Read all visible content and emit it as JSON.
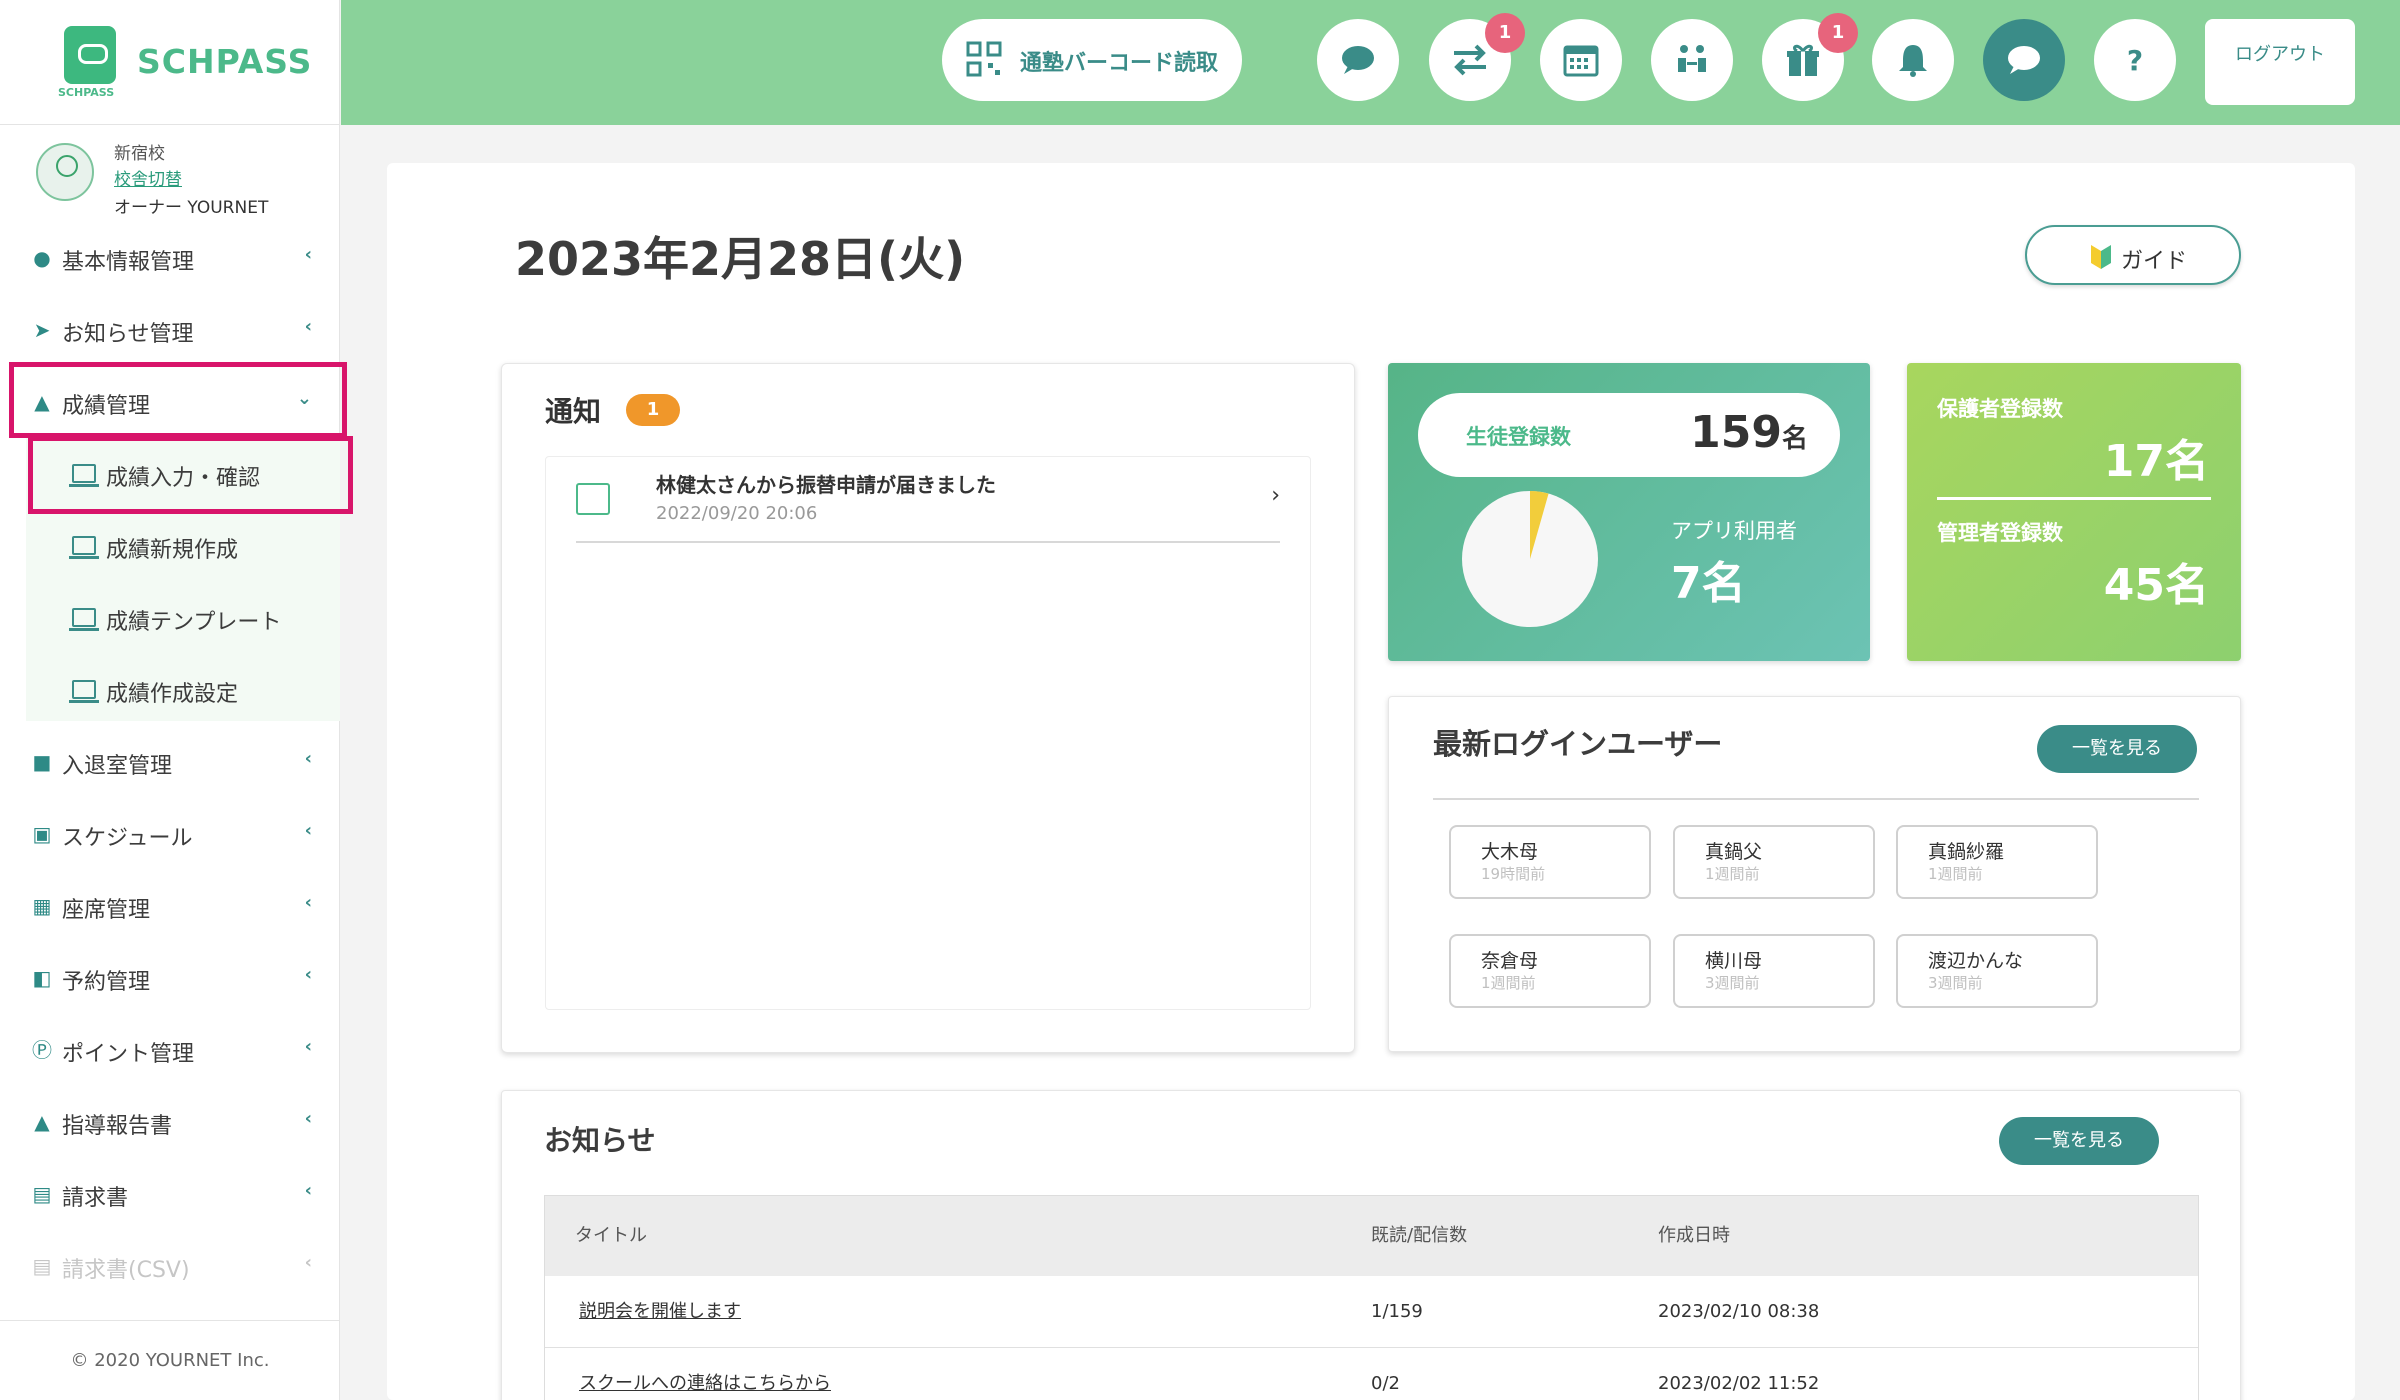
{
  "brand": {
    "name": "SCHPASS",
    "sub": "SCHPASS"
  },
  "school": {
    "name": "新宿校",
    "switch_label": "校舎切替",
    "owner": "オーナー YOURNET"
  },
  "sidebar": {
    "items": [
      {
        "label": "基本情報管理"
      },
      {
        "label": "お知らせ管理"
      },
      {
        "label": "成績管理"
      },
      {
        "label": "入退室管理"
      },
      {
        "label": "スケジュール"
      },
      {
        "label": "座席管理"
      },
      {
        "label": "予約管理"
      },
      {
        "label": "ポイント管理"
      },
      {
        "label": "指導報告書"
      },
      {
        "label": "請求書"
      },
      {
        "label": "請求書(CSV)"
      }
    ],
    "subitems": [
      {
        "label": "成績入力・確認"
      },
      {
        "label": "成績新規作成"
      },
      {
        "label": "成績テンプレート"
      },
      {
        "label": "成績作成設定"
      }
    ],
    "copyright": "© 2020 YOURNET Inc."
  },
  "topbar": {
    "barcode_label": "通塾バーコード読取",
    "badges": {
      "transfer": "1",
      "gift": "1"
    },
    "logout_label": "ログアウト"
  },
  "main": {
    "date": "2023年2月28日(火)",
    "guide_label": "ガイド"
  },
  "notifications": {
    "title": "通知",
    "count": "1",
    "items": [
      {
        "title": "林健太さんから振替申請が届きました",
        "date": "2022/09/20 20:06"
      }
    ]
  },
  "stats": {
    "students_label": "生徒登録数",
    "students_value": "159",
    "students_unit": "名",
    "app_users_label": "アプリ利用者",
    "app_users_value": "7名",
    "app_users_fraction": 0.044,
    "guardians_label": "保護者登録数",
    "guardians_value": "17名",
    "admins_label": "管理者登録数",
    "admins_value": "45名"
  },
  "login_users": {
    "title": "最新ログインユーザー",
    "view_all": "一覧を見る",
    "users": [
      {
        "name": "大木母",
        "time": "19時間前"
      },
      {
        "name": "真鍋父",
        "time": "1週間前"
      },
      {
        "name": "真鍋紗羅",
        "time": "1週間前"
      },
      {
        "name": "奈倉母",
        "time": "1週間前"
      },
      {
        "name": "横川母",
        "time": "3週間前"
      },
      {
        "name": "渡辺かんな",
        "time": "3週間前"
      }
    ]
  },
  "news": {
    "title": "お知らせ",
    "view_all": "一覧を見る",
    "columns": [
      "タイトル",
      "既読/配信数",
      "作成日時"
    ],
    "rows": [
      {
        "title": "説明会を開催します",
        "read": "1/159",
        "created": "2023/02/10 08:38"
      },
      {
        "title": "スクールへの連絡はこちらから",
        "read": "0/2",
        "created": "2023/02/02 11:52"
      }
    ]
  },
  "colors": {
    "accent": "#3a8c88",
    "topbar": "#8ad29a",
    "highlight": "#d8146a",
    "badge": "#e7647c"
  }
}
